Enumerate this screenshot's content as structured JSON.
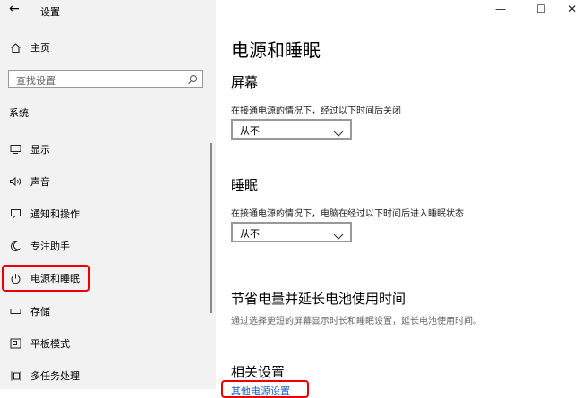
{
  "window": {
    "back_glyph": "←",
    "title": "设置",
    "minimize": "—",
    "maximize": "☐",
    "close": "✕"
  },
  "sidebar": {
    "home_label": "主页",
    "search_placeholder": "查找设置",
    "section_label": "系统",
    "items": [
      {
        "label": "显示",
        "icon": "display-icon"
      },
      {
        "label": "声音",
        "icon": "sound-icon"
      },
      {
        "label": "通知和操作",
        "icon": "notification-icon"
      },
      {
        "label": "专注助手",
        "icon": "moon-icon"
      },
      {
        "label": "电源和睡眠",
        "icon": "power-icon",
        "selected": true
      },
      {
        "label": "存储",
        "icon": "storage-icon"
      },
      {
        "label": "平板模式",
        "icon": "tablet-icon"
      },
      {
        "label": "多任务处理",
        "icon": "multitask-icon"
      }
    ]
  },
  "main": {
    "page_title": "电源和睡眠",
    "screen": {
      "title": "屏幕",
      "desc": "在接通电源的情况下，经过以下时间后关闭",
      "value": "从不"
    },
    "sleep": {
      "title": "睡眠",
      "desc": "在接通电源的情况下，电脑在经过以下时间后进入睡眠状态",
      "value": "从不"
    },
    "battery": {
      "title": "节省电量并延长电池使用时间",
      "desc": "通过选择更短的屏幕显示时长和睡眠设置，延长电池使用时间。"
    },
    "related": {
      "title": "相关设置",
      "link": "其他电源设置"
    }
  },
  "colors": {
    "sidebar_bg": "#f2f2f2",
    "highlight": "#e00000",
    "link": "#1a63c9"
  }
}
